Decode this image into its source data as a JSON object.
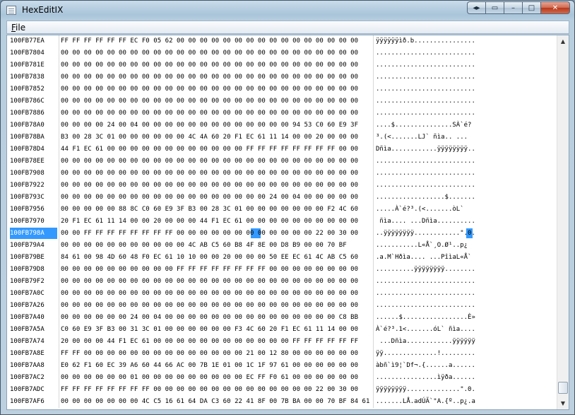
{
  "window": {
    "title": "HexEditIX",
    "controls": {
      "back": "◂▸",
      "copy": "▭",
      "minimize": "–",
      "maximize": "□",
      "close": "✕"
    }
  },
  "menu": {
    "items": [
      {
        "label": "File",
        "accelerator": "F"
      }
    ]
  },
  "selection": {
    "row_index": 16,
    "byte_index": 16,
    "address": "100FB7970",
    "byte": "F1",
    "char": "ñ"
  },
  "hexview": {
    "rows": [
      {
        "addr": "100FB77EA",
        "hex": "FF FF FF FF FF FF EC F0 05 62 00 00 00 00 00 00 00 00 00 00 00 00 00 00 00 00",
        "ascii": "ÿÿÿÿÿÿìð.b................"
      },
      {
        "addr": "100FB7804",
        "hex": "00 00 00 00 00 00 00 00 00 00 00 00 00 00 00 00 00 00 00 00 00 00 00 00 00 00",
        "ascii": ".........................."
      },
      {
        "addr": "100FB781E",
        "hex": "00 00 00 00 00 00 00 00 00 00 00 00 00 00 00 00 00 00 00 00 00 00 00 00 00 00",
        "ascii": ".........................."
      },
      {
        "addr": "100FB7838",
        "hex": "00 00 00 00 00 00 00 00 00 00 00 00 00 00 00 00 00 00 00 00 00 00 00 00 00 00",
        "ascii": ".........................."
      },
      {
        "addr": "100FB7852",
        "hex": "00 00 00 00 00 00 00 00 00 00 00 00 00 00 00 00 00 00 00 00 00 00 00 00 00 00",
        "ascii": ".........................."
      },
      {
        "addr": "100FB786C",
        "hex": "00 00 00 00 00 00 00 00 00 00 00 00 00 00 00 00 00 00 00 00 00 00 00 00 00 00",
        "ascii": ".........................."
      },
      {
        "addr": "100FB7886",
        "hex": "00 00 00 00 00 00 00 00 00 00 00 00 00 00 00 00 00 00 00 00 00 00 00 00 00 00",
        "ascii": ".........................."
      },
      {
        "addr": "100FB78A0",
        "hex": "00 00 00 00 24 00 04 00 00 00 00 00 00 00 00 00 00 00 00 00 94 53 C0 60 E9 3F",
        "ascii": "....$...............SÀ`é?"
      },
      {
        "addr": "100FB78BA",
        "hex": "B3 00 28 3C 01 00 00 00 00 00 00 4C 4A 60 20 F1 EC 61 11 14 00 00 20 00 00 00",
        "ascii": "³.(<.......LJ` ñìa.. ..."
      },
      {
        "addr": "100FB78D4",
        "hex": "44 F1 EC 61 00 00 00 00 00 00 00 00 00 00 00 00 FF FF FF FF FF FF FF FF 00 00",
        "ascii": "Dñìa............ÿÿÿÿÿÿÿÿ.."
      },
      {
        "addr": "100FB78EE",
        "hex": "00 00 00 00 00 00 00 00 00 00 00 00 00 00 00 00 00 00 00 00 00 00 00 00 00 00",
        "ascii": ".........................."
      },
      {
        "addr": "100FB7908",
        "hex": "00 00 00 00 00 00 00 00 00 00 00 00 00 00 00 00 00 00 00 00 00 00 00 00 00 00",
        "ascii": ".........................."
      },
      {
        "addr": "100FB7922",
        "hex": "00 00 00 00 00 00 00 00 00 00 00 00 00 00 00 00 00 00 00 00 00 00 00 00 00 00",
        "ascii": ".........................."
      },
      {
        "addr": "100FB793C",
        "hex": "00 00 00 00 00 00 00 00 00 00 00 00 00 00 00 00 00 00 24 00 04 00 00 00 00 00",
        "ascii": "..................$......."
      },
      {
        "addr": "100FB7956",
        "hex": "00 00 00 00 00 88 8C C0 60 E9 3F B3 00 28 3C 01 00 00 00 00 00 00 00 F2 4C 60",
        "ascii": ".....À`é?³.(<.......òL`"
      },
      {
        "addr": "100FB7970",
        "hex": "20 F1 EC 61 11 14 00 00 20 00 00 00 44 F1 EC 61 00 00 00 00 00 00 00 00 00 00",
        "ascii": " ñìa.... ...Dñìa.........."
      },
      {
        "addr": "100FB798A",
        "hex": "00 00 FF FF FF FF FF FF FF FF 00 00 00 00 00 00 00 00 00 00 00 00 22 00 30 00",
        "ascii": "..ÿÿÿÿÿÿÿÿ............\".0."
      },
      {
        "addr": "100FB79A4",
        "hex": "00 00 00 00 00 00 00 00 00 00 00 4C AB C5 60 B8 4F 8E 00 D8 B9 00 00 70 BF",
        "ascii": "...........L«Å`¸O.Ø¹..p¿"
      },
      {
        "addr": "100FB79BE",
        "hex": "84 61 00 98 4D 60 48 F0 EC 61 10 10 00 00 20 00 00 00 50 EE EC 61 4C AB C5 60",
        "ascii": ".a.M`Hðìa.... ...PîìaL«Å`"
      },
      {
        "addr": "100FB79D8",
        "hex": "00 00 00 00 00 00 00 00 00 00 FF FF FF FF FF FF FF FF 00 00 00 00 00 00 00 00",
        "ascii": "..........ÿÿÿÿÿÿÿÿ........"
      },
      {
        "addr": "100FB79F2",
        "hex": "00 00 00 00 00 00 00 00 00 00 00 00 00 00 00 00 00 00 00 00 00 00 00 00 00 00",
        "ascii": ".........................."
      },
      {
        "addr": "100FB7A0C",
        "hex": "00 00 00 00 00 00 00 00 00 00 00 00 00 00 00 00 00 00 00 00 00 00 00 00 00 00",
        "ascii": ".........................."
      },
      {
        "addr": "100FB7A26",
        "hex": "00 00 00 00 00 00 00 00 00 00 00 00 00 00 00 00 00 00 00 00 00 00 00 00 00 00",
        "ascii": ".........................."
      },
      {
        "addr": "100FB7A40",
        "hex": "00 00 00 00 00 00 24 00 04 00 00 00 00 00 00 00 00 00 00 00 00 00 00 00 C8 BB",
        "ascii": "......$.................È»"
      },
      {
        "addr": "100FB7A5A",
        "hex": "C0 60 E9 3F B3 00 31 3C 01 00 00 00 00 00 00 F3 4C 60 20 F1 EC 61 11 14 00 00",
        "ascii": "À`é?³.1<.......óL` ñìa...."
      },
      {
        "addr": "100FB7A74",
        "hex": "20 00 00 00 44 F1 EC 61 00 00 00 00 00 00 00 00 00 00 00 00 FF FF FF FF FF FF",
        "ascii": " ...Dñìa............ÿÿÿÿÿÿ"
      },
      {
        "addr": "100FB7A8E",
        "hex": "FF FF 00 00 00 00 00 00 00 00 00 00 00 00 00 00 21 00 12 80 00 00 00 00 00 00",
        "ascii": "ÿÿ..............!........."
      },
      {
        "addr": "100FB7AA8",
        "hex": "E0 62 F1 60 EC 39 A6 60 44 66 AC 00 7B 1E 01 00 1C 1F 97 61 00 00 00 00 00 00",
        "ascii": "àbñ`ì9¦`Df¬.{......a......"
      },
      {
        "addr": "100FB7AC2",
        "hex": "00 00 00 00 00 00 01 00 00 00 00 00 00 00 00 00 EC FF F0 61 00 00 00 00 00 00",
        "ascii": "................ìÿða......"
      },
      {
        "addr": "100FB7ADC",
        "hex": "FF FF FF FF FF FF FF FF 00 00 00 00 00 00 00 00 00 00 00 00 00 00 22 00 30 00",
        "ascii": "ÿÿÿÿÿÿÿÿ..............\".0."
      },
      {
        "addr": "100FB7AF6",
        "hex": "00 00 00 00 00 00 00 4C C5 16 61 64 DA C3 60 22 41 8F 00 7B BA 00 00 70 BF 84 61",
        "ascii": ".......LÅ.adÚÃ`\"A.{º..p¿.a"
      }
    ]
  }
}
